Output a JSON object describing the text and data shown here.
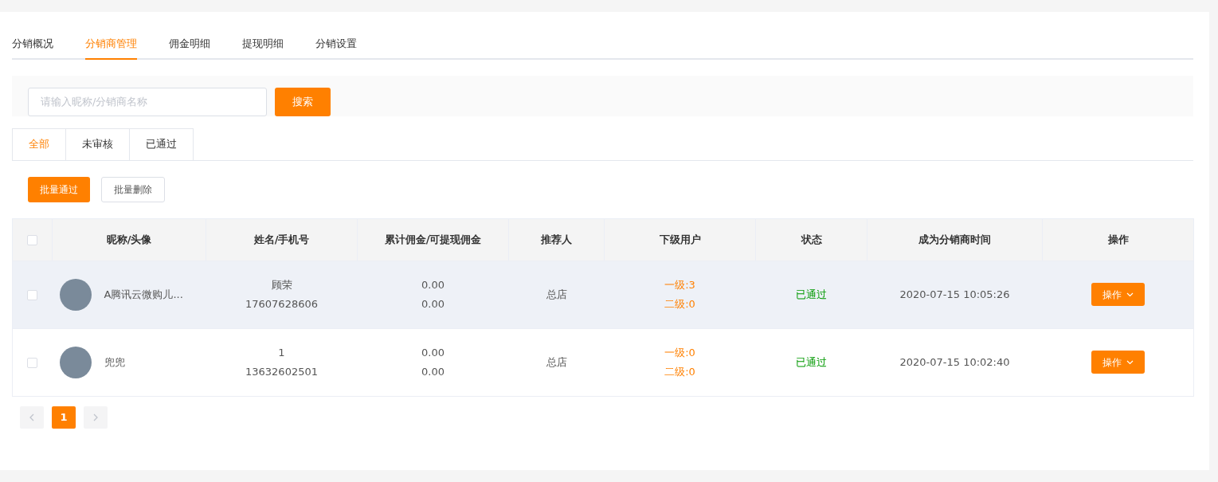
{
  "main_tabs": [
    {
      "label": "分销概况",
      "selected": false
    },
    {
      "label": "分销商管理",
      "selected": true
    },
    {
      "label": "佣金明细",
      "selected": false
    },
    {
      "label": "提现明细",
      "selected": false
    },
    {
      "label": "分销设置",
      "selected": false
    }
  ],
  "search": {
    "placeholder": "请输入昵称/分销商名称",
    "button": "搜索"
  },
  "filter_tabs": [
    {
      "label": "全部",
      "selected": true
    },
    {
      "label": "未审核",
      "selected": false
    },
    {
      "label": "已通过",
      "selected": false
    }
  ],
  "bulk_actions": [
    {
      "label": "批量通过",
      "kind": "primary"
    },
    {
      "label": "批量删除",
      "kind": "outline"
    }
  ],
  "table": {
    "select_all_checked": false,
    "columns": [
      "昵称/头像",
      "姓名/手机号",
      "累计佣金/可提现佣金",
      "推荐人",
      "下级用户",
      "状态",
      "成为分销商时间",
      "操作"
    ],
    "rows": [
      {
        "checked": false,
        "highlighted": true,
        "nickname": "A腾讯云微购儿...",
        "name": "顾荣",
        "phone": "17607628606",
        "total_commission": "0.00",
        "withdrawable_commission": "0.00",
        "referrer": "总店",
        "level_1": "一级:3",
        "level_2": "二级:0",
        "status": "已通过",
        "time": "2020-07-15 10:05:26",
        "action": "操作"
      },
      {
        "checked": false,
        "highlighted": false,
        "nickname": "兜兜",
        "name": "1",
        "phone": "13632602501",
        "total_commission": "0.00",
        "withdrawable_commission": "0.00",
        "referrer": "总店",
        "level_1": "一级:0",
        "level_2": "二级:0",
        "status": "已通过",
        "time": "2020-07-15 10:02:40",
        "action": "操作"
      }
    ]
  },
  "pagination": {
    "prev_disabled": true,
    "next_disabled": true,
    "pages": [
      {
        "label": "1",
        "selected": true
      }
    ]
  }
}
